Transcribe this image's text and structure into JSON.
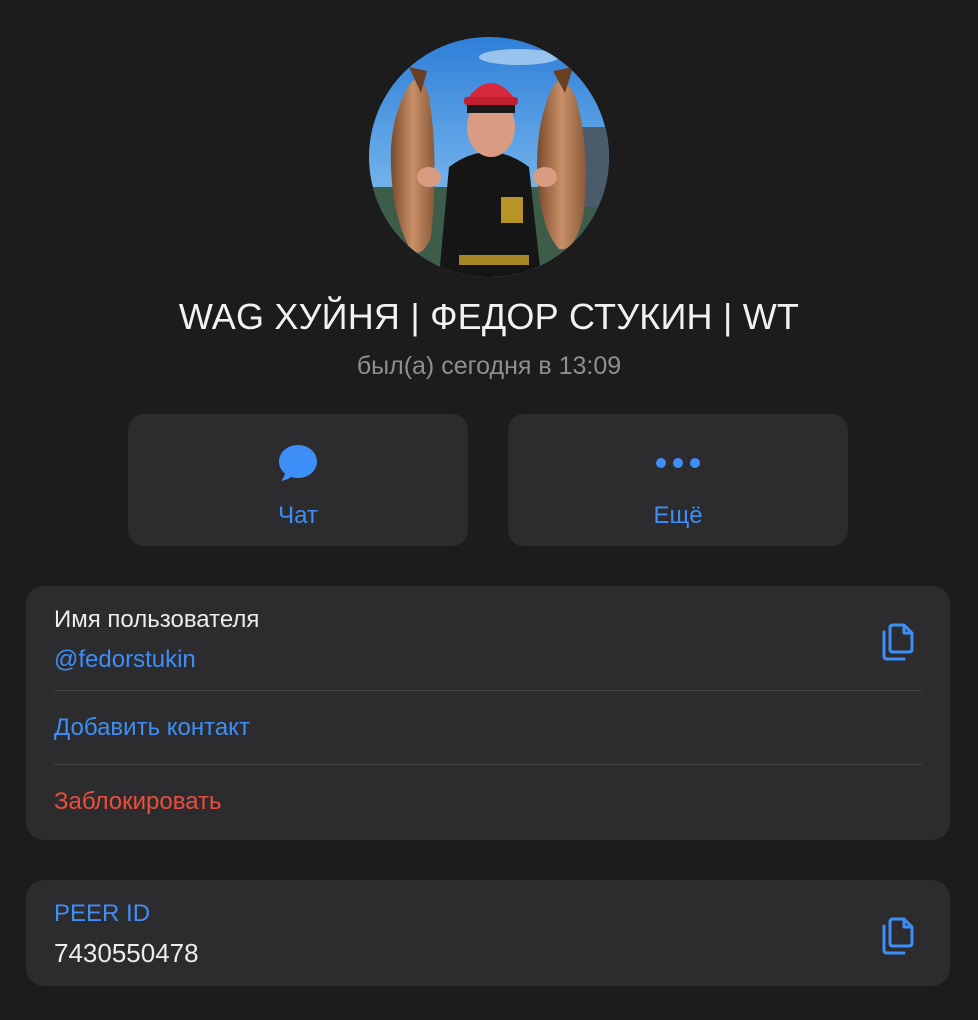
{
  "profile": {
    "name": "WAG ХУЙНЯ | ФЕДОР СТУКИН | WT",
    "status": "был(а) сегодня в 13:09",
    "avatar_icon": "profile-photo"
  },
  "actions": {
    "chat_label": "Чат",
    "chat_icon": "chat-bubble-icon",
    "more_label": "Ещё",
    "more_icon": "ellipsis-icon"
  },
  "info": {
    "username_label": "Имя пользователя",
    "username_value": "@fedorstukin",
    "add_contact_label": "Добавить контакт",
    "block_label": "Заблокировать",
    "copy_icon": "copy-icon"
  },
  "peer": {
    "label": "PEER ID",
    "value": "7430550478",
    "copy_icon": "copy-icon"
  },
  "colors": {
    "background": "#1c1c1d",
    "card": "#2c2c2e",
    "accent": "#3e8ef7",
    "danger": "#eb4d3d",
    "secondary_text": "#8e8e93"
  }
}
